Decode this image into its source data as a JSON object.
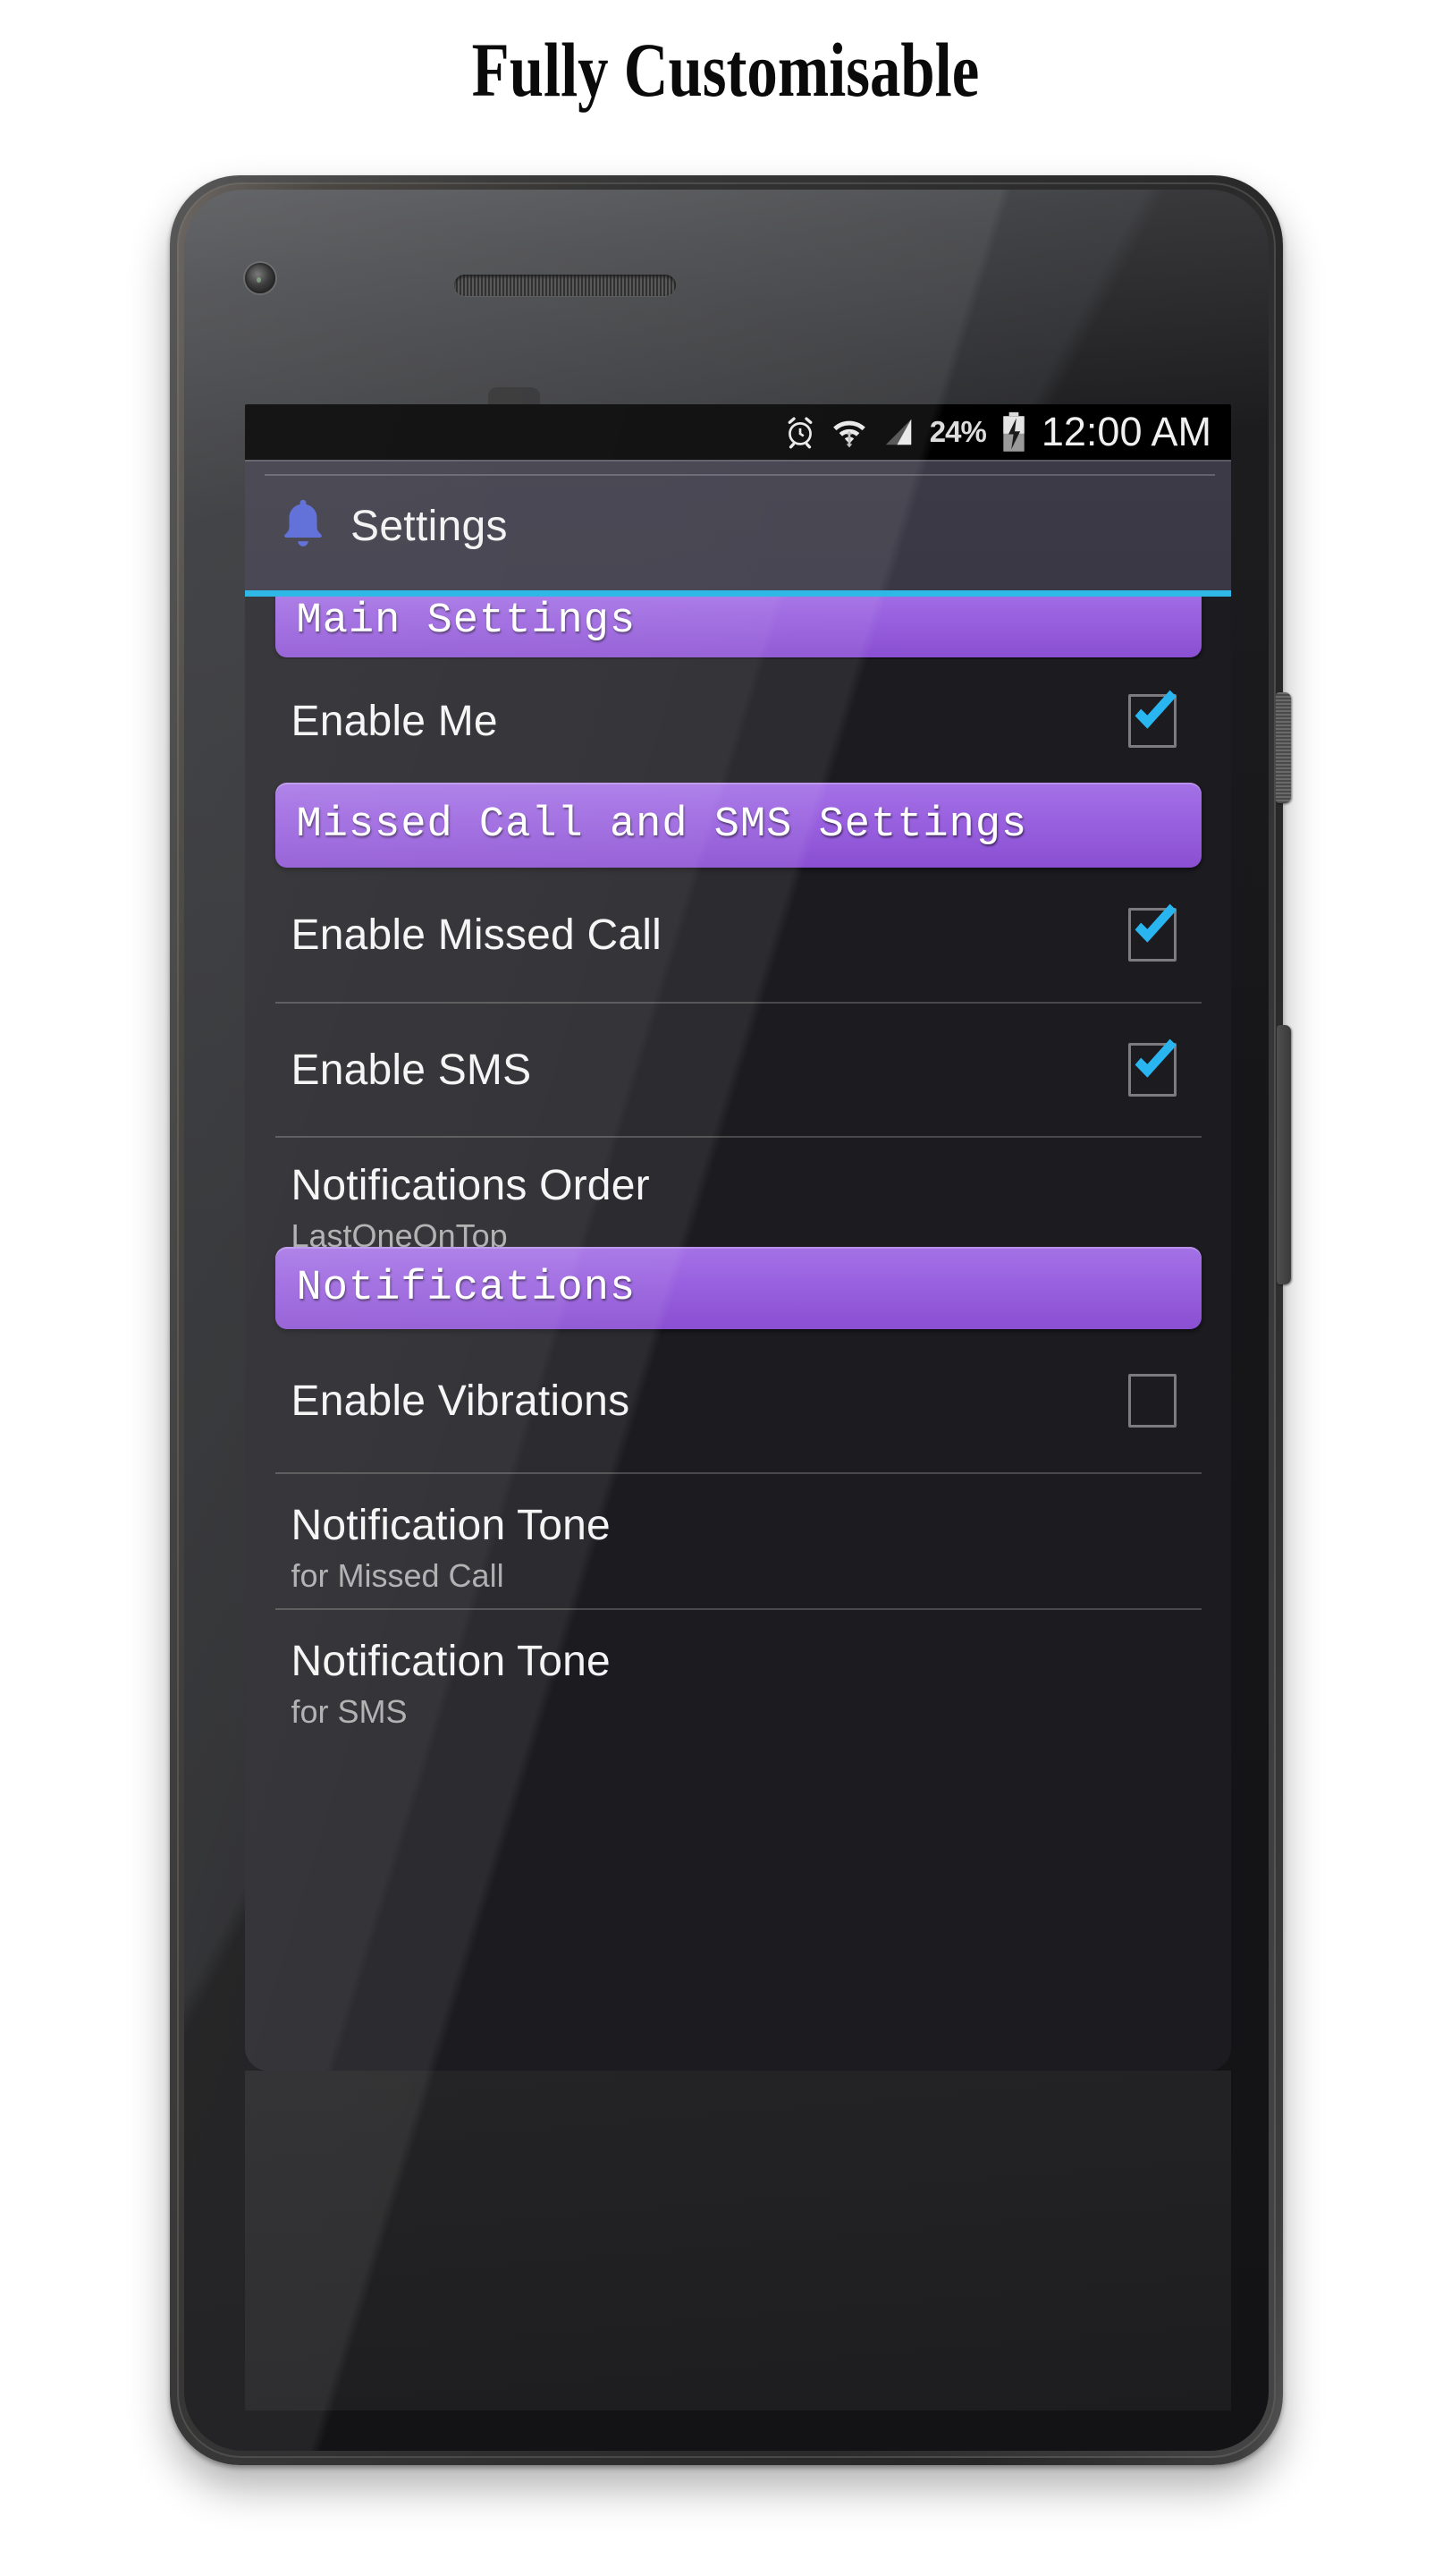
{
  "page": {
    "headline": "Fully Customisable"
  },
  "status_bar": {
    "alarm_icon": "alarm-clock-icon",
    "wifi_icon": "wifi-icon",
    "signal_icon": "signal-bars-icon",
    "battery_percent": "24%",
    "battery_icon": "battery-charging-icon",
    "clock": "12:00 AM"
  },
  "app_bar": {
    "icon": "bell-icon",
    "title": "Settings",
    "accent_color": "#2fb8e6"
  },
  "sections": {
    "main": "Main Settings",
    "missed_call_sms": "Missed Call and SMS Settings",
    "notifications": "Notifications"
  },
  "rows": {
    "enable_me": {
      "title": "Enable Me",
      "subtitle": "",
      "checked": true
    },
    "enable_missed_call": {
      "title": "Enable Missed Call",
      "subtitle": "",
      "checked": true
    },
    "enable_sms": {
      "title": "Enable SMS",
      "subtitle": "",
      "checked": true
    },
    "notifications_order": {
      "title": "Notifications Order",
      "subtitle": "LastOneOnTop"
    },
    "enable_vibrations": {
      "title": "Enable Vibrations",
      "subtitle": "",
      "checked": false
    },
    "tone_missed_call": {
      "title": "Notification Tone",
      "subtitle": "for Missed Call"
    },
    "tone_sms": {
      "title": "Notification Tone",
      "subtitle": "for SMS"
    }
  },
  "colors": {
    "section_purple_top": "#a472e6",
    "section_purple_bottom": "#8a4fd2",
    "accent_cyan": "#2fb8e6",
    "checkbox_check": "#29b6f0",
    "screen_bg": "#1b1b20",
    "appbar_bg": "#3a3845"
  },
  "hardware": {
    "camera": "front-camera",
    "speaker": "earpiece-speaker",
    "sensor": "proximity-sensor",
    "power_button": "power-button",
    "volume_button": "volume-rocker"
  }
}
